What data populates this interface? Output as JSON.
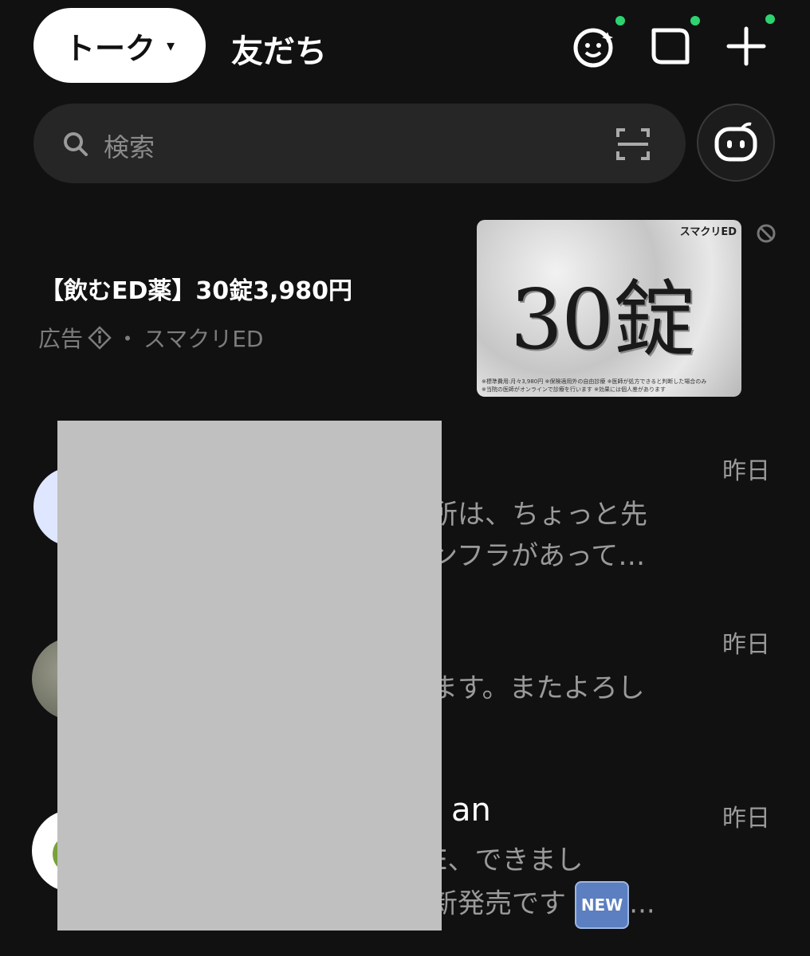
{
  "header": {
    "active_tab": "トーク",
    "caret": "▾",
    "other_tab": "友だち",
    "icons": [
      "face-sparkle-icon",
      "chat-bubble-square-icon",
      "plus-icon"
    ],
    "notification_dot_color": "#2dd36f"
  },
  "search": {
    "placeholder": "検索",
    "icons": [
      "search-icon",
      "qr-scan-icon",
      "bot-icon"
    ]
  },
  "ad": {
    "title": "【飲むED薬】30錠3,980円",
    "label": "広告",
    "separator": "・",
    "advertiser": "スマクリED",
    "image_brand": "スマクリED",
    "image_headline": "30錠",
    "image_fine_print_1": "※標準費用:月々3,980円 ※保険適用外の自由診療 ※医師が処方できると判断した場合のみ",
    "image_fine_print_2": "※当院の医師がオンラインで診療を行います ※効果には個人差があります"
  },
  "chats": [
    {
      "time": "昨日",
      "line1": "所は、ちょっと先",
      "line2": "ンフラがあって…"
    },
    {
      "time": "昨日",
      "line1": "ます。またよろし"
    },
    {
      "time": "昨日",
      "name_fragment": "an",
      "line1": "E、できまし",
      "line2": "新発売です",
      "badge": "NEW",
      "ellipsis": "..."
    }
  ]
}
